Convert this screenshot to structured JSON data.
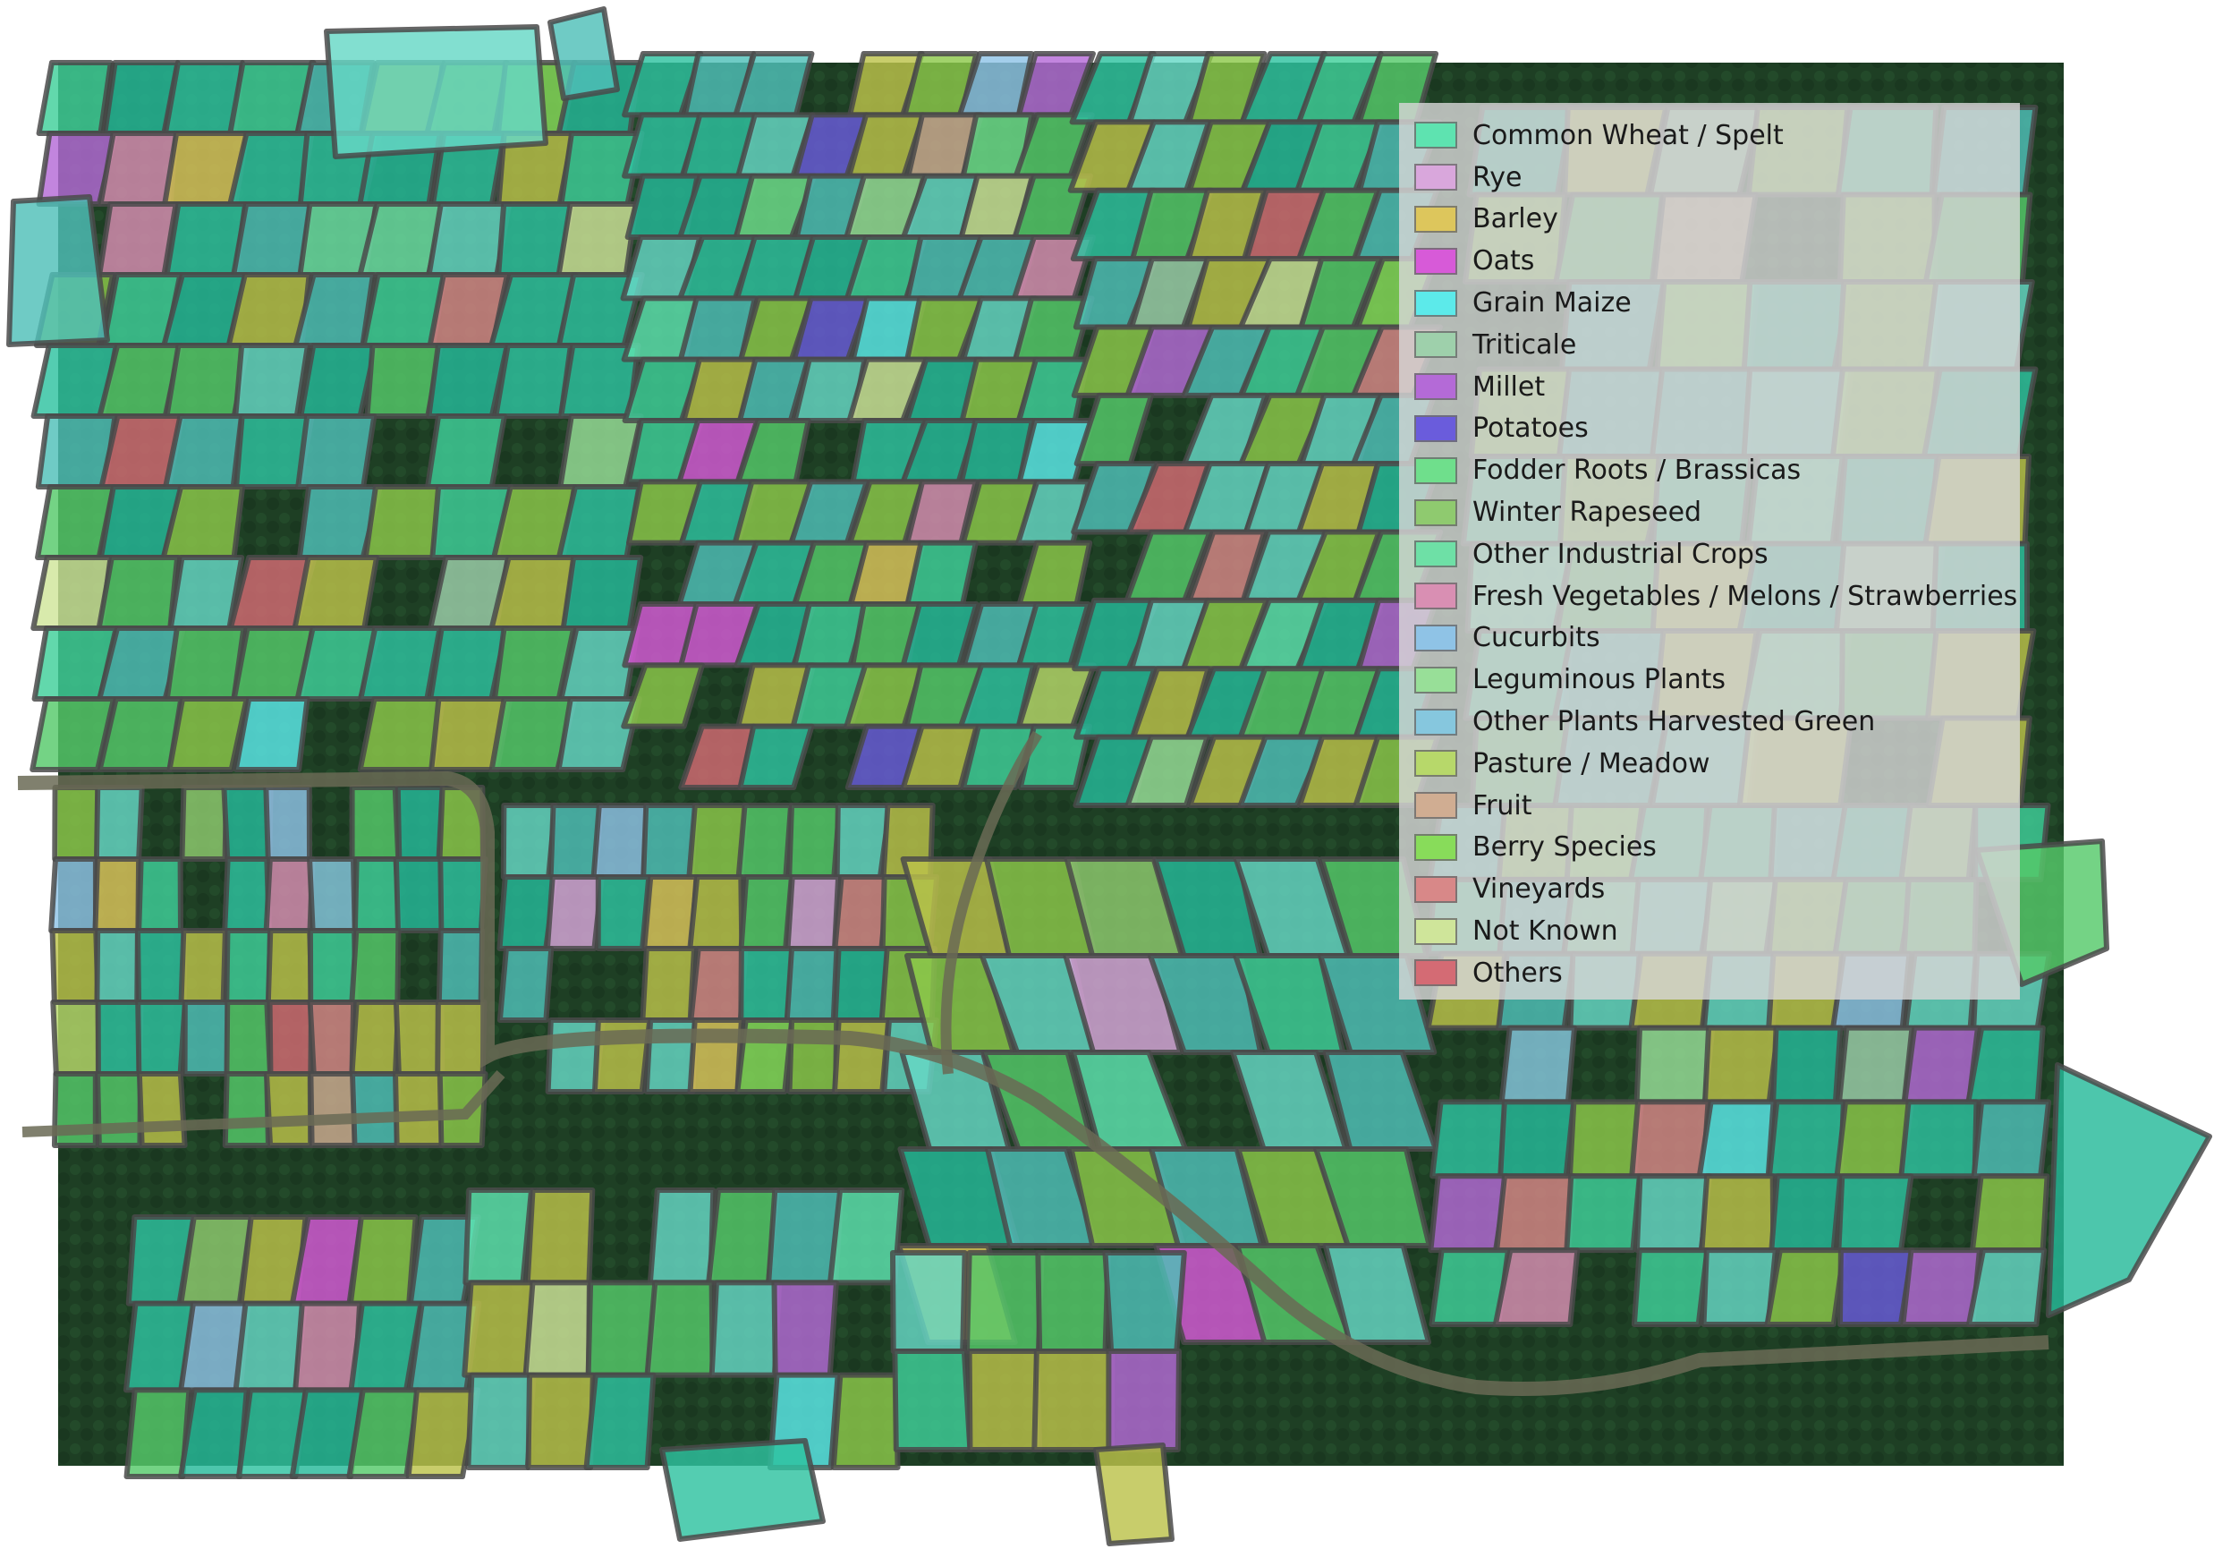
{
  "legend": {
    "items": [
      {
        "label": "Common Wheat / Spelt",
        "color": "#5ee3b0"
      },
      {
        "label": "Rye",
        "color": "#d9a7dc"
      },
      {
        "label": "Barley",
        "color": "#ddc65c"
      },
      {
        "label": "Oats",
        "color": "#d75ad8"
      },
      {
        "label": "Grain Maize",
        "color": "#5ceaea"
      },
      {
        "label": "Triticale",
        "color": "#9ed0ab"
      },
      {
        "label": "Millet",
        "color": "#b46ad7"
      },
      {
        "label": "Potatoes",
        "color": "#6a5cdc"
      },
      {
        "label": "Fodder Roots / Brassicas",
        "color": "#6fdf8c"
      },
      {
        "label": "Winter Rapeseed",
        "color": "#8fca6f"
      },
      {
        "label": "Other Industrial Crops",
        "color": "#6ee0a6"
      },
      {
        "label": "Fresh Vegetables / Melons / Strawberries",
        "color": "#d98fb3"
      },
      {
        "label": "Cucurbits",
        "color": "#8fc3e6"
      },
      {
        "label": "Leguminous Plants",
        "color": "#98df98"
      },
      {
        "label": "Other Plants Harvested Green",
        "color": "#86c7de"
      },
      {
        "label": "Pasture / Meadow",
        "color": "#b7d86a"
      },
      {
        "label": "Fruit",
        "color": "#d0ad92"
      },
      {
        "label": "Berry Species",
        "color": "#88dc5a"
      },
      {
        "label": "Vineyards",
        "color": "#d88888"
      },
      {
        "label": "Not Known",
        "color": "#cfe59a"
      },
      {
        "label": "Others",
        "color": "#d46b74"
      }
    ]
  },
  "map": {
    "background_color": "#1d3d22",
    "border_color": "#4a4a4a",
    "parcel_colors": [
      "#2ec2a0",
      "#26b99a",
      "#3fcf9a",
      "#bcc24a",
      "#56c96a",
      "#8cc84a",
      "#66d8c6",
      "#4fbfb8"
    ]
  }
}
